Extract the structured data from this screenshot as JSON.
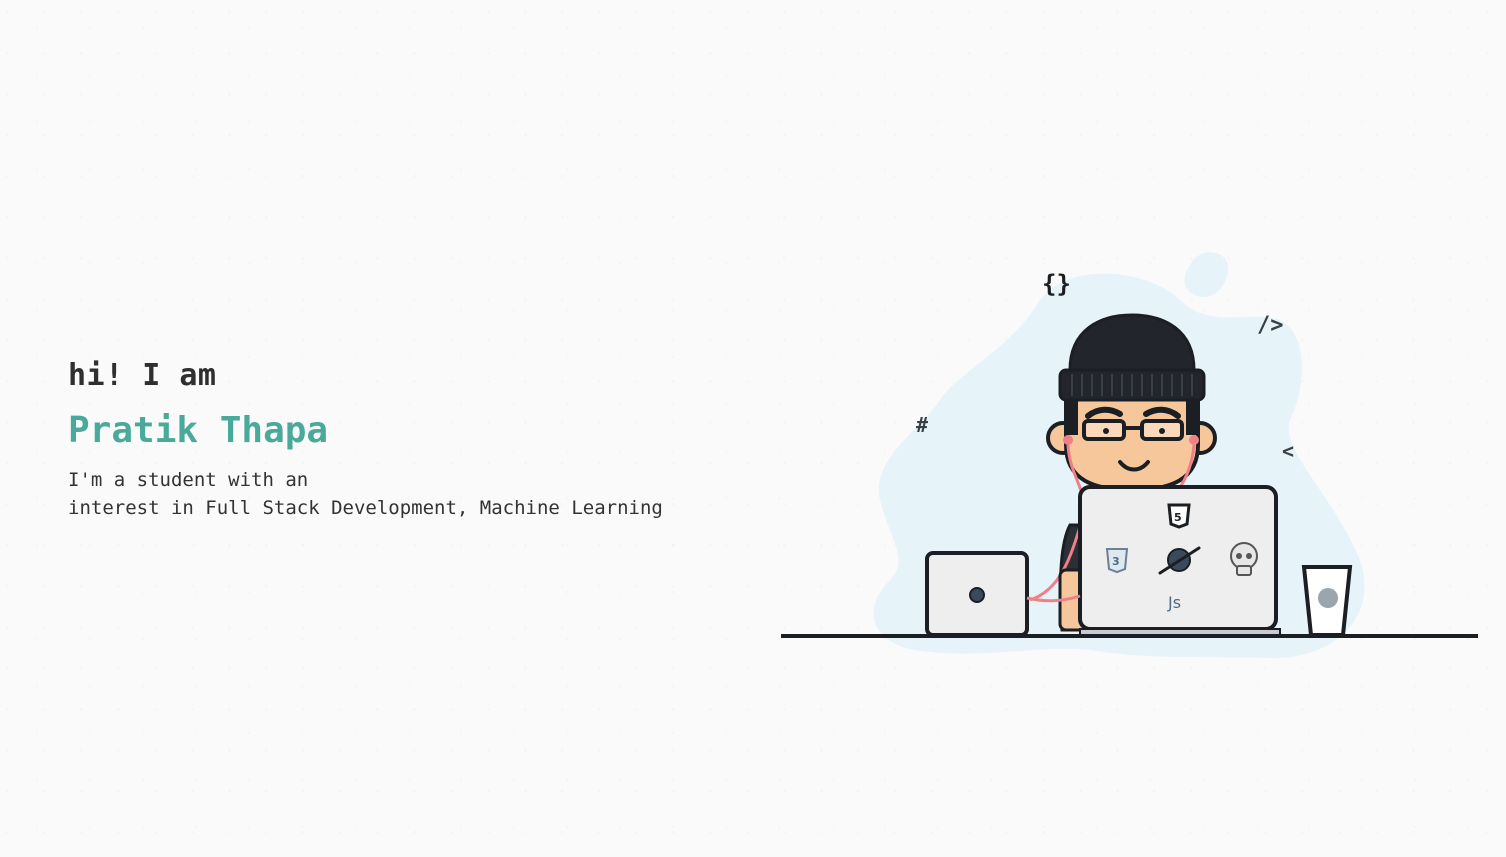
{
  "hero": {
    "greeting": "hi! I am",
    "name": "Pratik Thapa",
    "bio_line1": "I'm a student with an",
    "bio_line2": "interest in Full Stack Development, Machine Learning"
  },
  "illustration": {
    "laptop_label": "Js",
    "code_symbols": [
      "{}",
      "/>",
      "#",
      "<"
    ]
  },
  "colors": {
    "accent": "#4aaa9a",
    "text": "#2f2f2f",
    "blob": "#e6f4f9",
    "line": "#1b1f24"
  }
}
